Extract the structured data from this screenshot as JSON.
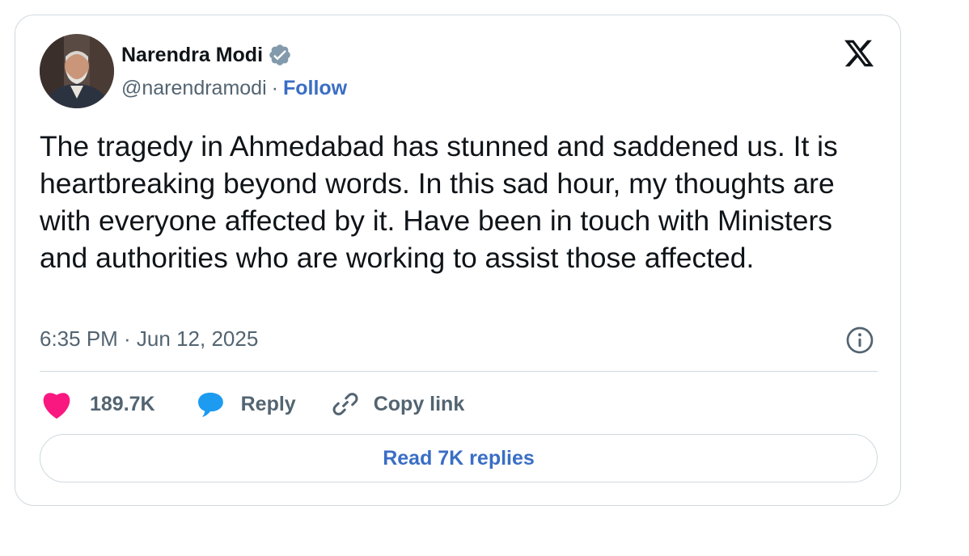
{
  "author": {
    "name": "Narendra Modi",
    "handle": "@narendramodi",
    "separator": "·",
    "follow_label": "Follow",
    "verified_icon": "verified-badge-icon",
    "verified_color": "#829aab"
  },
  "brand": {
    "logo": "x-logo-icon"
  },
  "tweet": {
    "text": "The tragedy in Ahmedabad has stunned and saddened us. It is heartbreaking beyond words. In this sad hour, my thoughts are with everyone affected by it. Have been in touch with Ministers and authorities who are working to assist those affected.",
    "timestamp": "6:35 PM · Jun 12, 2025",
    "info_icon": "info-icon"
  },
  "actions": {
    "like": {
      "icon": "heart-icon",
      "label": "189.7K",
      "color": "#f91880"
    },
    "reply": {
      "icon": "reply-bubble-icon",
      "label": "Reply",
      "color": "#1d9bf0"
    },
    "copy": {
      "icon": "link-icon",
      "label": "Copy link"
    }
  },
  "read_replies_label": "Read 7K replies",
  "colors": {
    "accent": "#3a6ec5",
    "text": "#0f1419",
    "muted": "#536471",
    "border": "#cfd9de"
  }
}
